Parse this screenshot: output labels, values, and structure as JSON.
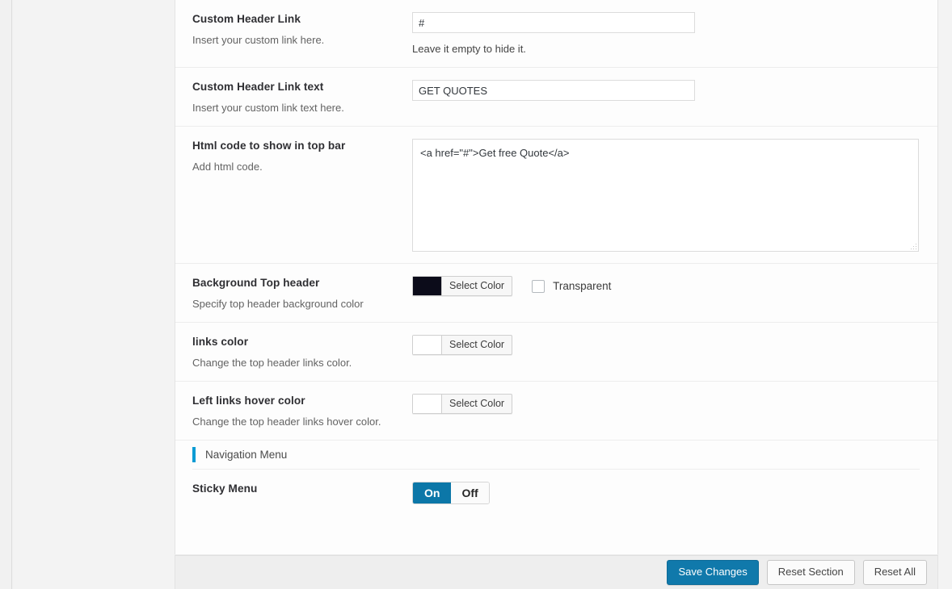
{
  "panel": {
    "accent_color": "#0c9bd4",
    "primary_button_color": "#1079ab",
    "fields": [
      {
        "id": "custom-header-link",
        "title": "Custom Header Link",
        "description": "Insert your custom link here.",
        "type": "text",
        "value": "#",
        "placeholder": "",
        "hint": "Leave it empty to hide it."
      },
      {
        "id": "custom-header-link-text",
        "title": "Custom Header Link text",
        "description": "Insert your custom link text here.",
        "type": "text",
        "value": "GET QUOTES",
        "placeholder": "",
        "hint": ""
      },
      {
        "id": "html-code-top-bar",
        "title": "Html code to show in top bar",
        "description": "Add html code.",
        "type": "textarea",
        "value": "<a href=\"#\">Get free Quote</a>",
        "placeholder": ""
      },
      {
        "id": "background-top-header",
        "title": "Background Top header",
        "description": "Specify top header background color",
        "type": "color",
        "swatch_color": "#0c0c1a",
        "button_label": "Select Color",
        "checkbox_label": "Transparent",
        "checkbox_checked": false
      },
      {
        "id": "links-color",
        "title": "links color",
        "description": "Change the top header links color.",
        "type": "color",
        "swatch_color": "#ffffff",
        "button_label": "Select Color"
      },
      {
        "id": "left-links-hover-color",
        "title": "Left links hover color",
        "description": "Change the top header links hover color.",
        "type": "color",
        "swatch_color": "#ffffff",
        "button_label": "Select Color"
      }
    ],
    "section_header": {
      "title": "Navigation Menu"
    },
    "sticky_menu": {
      "title": "Sticky Menu",
      "on_label": "On",
      "off_label": "Off",
      "state": "On"
    }
  },
  "footer": {
    "save_label": "Save Changes",
    "reset_section_label": "Reset Section",
    "reset_all_label": "Reset All"
  }
}
